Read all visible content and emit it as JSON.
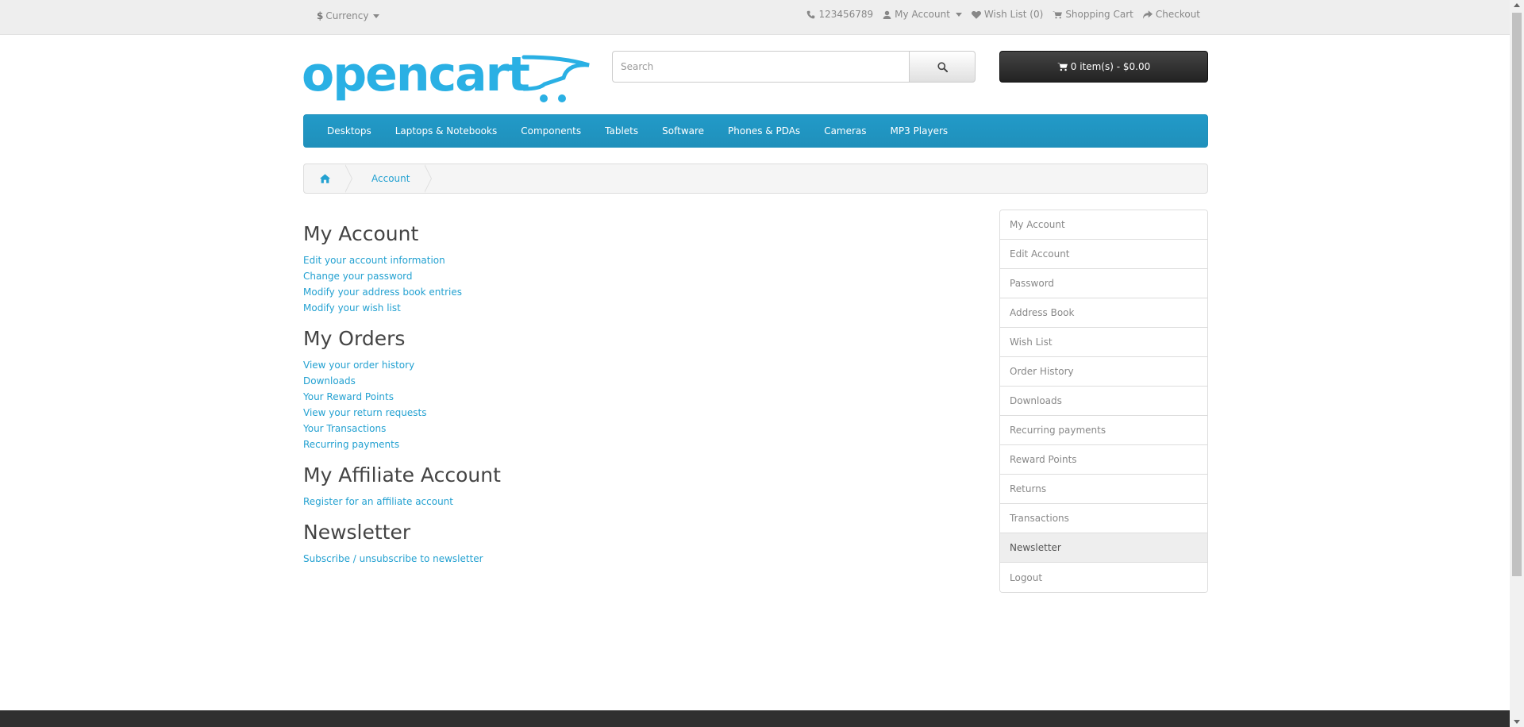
{
  "topbar": {
    "currency_symbol": "$",
    "currency_label": "Currency",
    "phone": "123456789",
    "my_account": "My Account",
    "wishlist": "Wish List (0)",
    "shopping_cart": "Shopping Cart",
    "checkout": "Checkout"
  },
  "header": {
    "logo_text": "opencart",
    "search_placeholder": "Search",
    "cart_label": "0 item(s) - $0.00"
  },
  "colors": {
    "accent": "#23a1d1",
    "menu": "#229ac8",
    "logo": "#2ab0e4"
  },
  "menu": {
    "items": [
      "Desktops",
      "Laptops & Notebooks",
      "Components",
      "Tablets",
      "Software",
      "Phones & PDAs",
      "Cameras",
      "MP3 Players"
    ]
  },
  "breadcrumb": {
    "home_icon": "home-icon",
    "current": "Account"
  },
  "sections": [
    {
      "title": "My Account",
      "links": [
        "Edit your account information",
        "Change your password",
        "Modify your address book entries",
        "Modify your wish list"
      ]
    },
    {
      "title": "My Orders",
      "links": [
        "View your order history",
        "Downloads",
        "Your Reward Points",
        "View your return requests",
        "Your Transactions",
        "Recurring payments"
      ]
    },
    {
      "title": "My Affiliate Account",
      "links": [
        "Register for an affiliate account"
      ]
    },
    {
      "title": "Newsletter",
      "links": [
        "Subscribe / unsubscribe to newsletter"
      ]
    }
  ],
  "sidebar": {
    "items": [
      "My Account",
      "Edit Account",
      "Password",
      "Address Book",
      "Wish List",
      "Order History",
      "Downloads",
      "Recurring payments",
      "Reward Points",
      "Returns",
      "Transactions",
      "Newsletter",
      "Logout"
    ],
    "active": "Newsletter"
  }
}
